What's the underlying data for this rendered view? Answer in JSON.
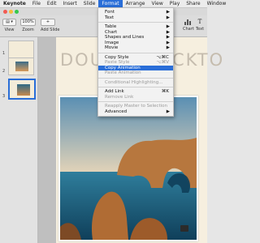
{
  "menubar": {
    "apple": "",
    "items": [
      "Keynote",
      "File",
      "Edit",
      "Insert",
      "Slide",
      "Format",
      "Arrange",
      "View",
      "Play",
      "Share",
      "Window"
    ]
  },
  "toolbar": {
    "view_label": "View",
    "zoom_value": "100%",
    "zoom_label": "Zoom",
    "add_slide_label": "Add Slide",
    "chart_label": "Chart",
    "text_label": "Text"
  },
  "slides": {
    "numbers": [
      "1",
      "2",
      "3"
    ]
  },
  "slide": {
    "headline": "DOUBLECLICKTO"
  },
  "format_menu": {
    "items": [
      {
        "label": "Font",
        "arrow": "▶"
      },
      {
        "label": "Text",
        "arrow": "▶"
      },
      {
        "sep": true
      },
      {
        "label": "Table",
        "arrow": "▶"
      },
      {
        "label": "Chart",
        "arrow": "▶"
      },
      {
        "label": "Shapes and Lines",
        "arrow": "▶"
      },
      {
        "label": "Image",
        "arrow": "▶"
      },
      {
        "label": "Movie",
        "arrow": "▶"
      },
      {
        "sep": true
      },
      {
        "label": "Copy Style",
        "shortcut": "⌥⌘C"
      },
      {
        "label": "Paste Style",
        "shortcut": "⌥⌘V",
        "disabled": true
      },
      {
        "label": "Copy Animation",
        "highlighted": true
      },
      {
        "label": "Paste Animation",
        "disabled": true
      },
      {
        "sep": true
      },
      {
        "label": "Conditional Highlighting...",
        "disabled": true
      },
      {
        "sep": true
      },
      {
        "label": "Add Link",
        "shortcut": "⌘K"
      },
      {
        "label": "Remove Link",
        "disabled": true
      },
      {
        "sep": true
      },
      {
        "label": "Reapply Master to Selection",
        "disabled": true
      },
      {
        "label": "Advanced",
        "arrow": "▶"
      }
    ]
  }
}
